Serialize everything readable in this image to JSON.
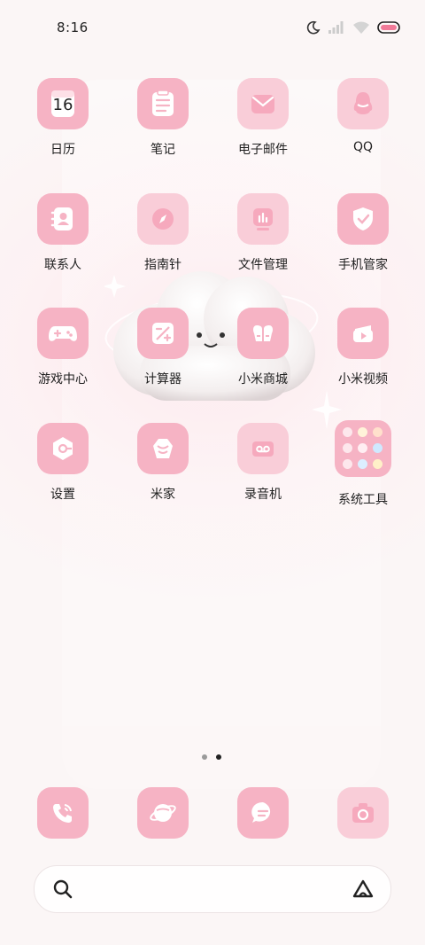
{
  "status": {
    "time": "8:16",
    "icons": [
      "moon-icon",
      "signal-icon",
      "wifi-icon",
      "battery-icon"
    ]
  },
  "apps": [
    {
      "label": "日历",
      "icon": "calendar-icon",
      "badge": "16"
    },
    {
      "label": "笔记",
      "icon": "notes-icon"
    },
    {
      "label": "电子邮件",
      "icon": "mail-icon"
    },
    {
      "label": "QQ",
      "icon": "qq-penguin-icon"
    },
    {
      "label": "联系人",
      "icon": "contacts-icon"
    },
    {
      "label": "指南针",
      "icon": "compass-icon"
    },
    {
      "label": "文件管理",
      "icon": "file-manager-icon"
    },
    {
      "label": "手机管家",
      "icon": "shield-icon"
    },
    {
      "label": "游戏中心",
      "icon": "gamepad-icon"
    },
    {
      "label": "计算器",
      "icon": "calculator-icon"
    },
    {
      "label": "小米商城",
      "icon": "mitten-store-icon"
    },
    {
      "label": "小米视频",
      "icon": "video-icon"
    },
    {
      "label": "设置",
      "icon": "settings-icon"
    },
    {
      "label": "米家",
      "icon": "mijia-icon"
    },
    {
      "label": "录音机",
      "icon": "recorder-icon"
    },
    {
      "label": "系统工具",
      "icon": "folder-icon"
    }
  ],
  "dock": [
    {
      "name": "phone",
      "icon": "phone-icon"
    },
    {
      "name": "browser",
      "icon": "planet-browser-icon"
    },
    {
      "name": "messages",
      "icon": "message-icon"
    },
    {
      "name": "camera",
      "icon": "camera-icon"
    }
  ],
  "page_indicator": {
    "pages": 2,
    "current": 2
  },
  "search": {
    "left_icon": "search-icon",
    "right_icon": "assistant-icon"
  },
  "colors": {
    "tile_dark": "#f6b3c4",
    "tile_light": "#f9cdd8",
    "glyph": "#ffffff",
    "text": "#1f1f1f"
  }
}
